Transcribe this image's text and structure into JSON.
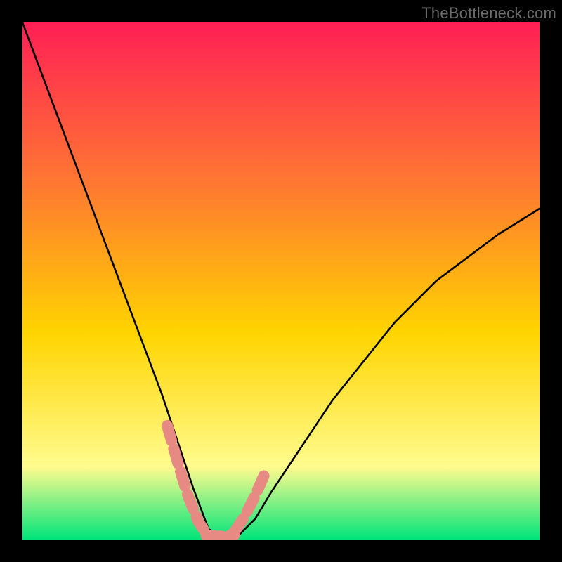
{
  "watermark": {
    "text": "TheBottleneck.com"
  },
  "colors": {
    "background": "#000000",
    "gradient_top": "#ff1f55",
    "gradient_mid1": "#ff7a30",
    "gradient_mid2": "#ffd400",
    "gradient_mid3": "#fffb8e",
    "gradient_bottom": "#00e47a",
    "curve": "#000000",
    "marker": "#e78a84"
  },
  "chart_data": {
    "type": "line",
    "title": "",
    "xlabel": "",
    "ylabel": "",
    "xlim": [
      0,
      100
    ],
    "ylim": [
      0,
      100
    ],
    "grid": false,
    "legend": false,
    "note": "Bottleneck-style curve: y ≈ percentage bottleneck vs. a sweep parameter; minimum (~0) around x≈34–41, rising on both sides.",
    "series": [
      {
        "name": "bottleneck-curve",
        "x": [
          0,
          3,
          6,
          9,
          12,
          15,
          18,
          21,
          24,
          27,
          30,
          33,
          36,
          39,
          42,
          45,
          48,
          52,
          56,
          60,
          64,
          68,
          72,
          76,
          80,
          84,
          88,
          92,
          96,
          100
        ],
        "y": [
          100,
          92,
          84,
          76,
          68,
          60,
          52,
          44,
          36,
          28,
          19,
          10,
          2,
          0.5,
          1,
          4,
          9,
          15,
          21,
          27,
          32,
          37,
          42,
          46,
          50,
          53,
          56,
          59,
          61.5,
          64
        ]
      }
    ],
    "markers": {
      "name": "emphasis-segments",
      "segments": [
        {
          "x": [
            28,
            30,
            32,
            34,
            35.5
          ],
          "y": [
            22,
            15,
            8.5,
            3.5,
            1.2
          ]
        },
        {
          "x": [
            35.5,
            38,
            41
          ],
          "y": [
            0.8,
            0.6,
            0.9
          ]
        },
        {
          "x": [
            41,
            43,
            45,
            47
          ],
          "y": [
            1.5,
            4.5,
            8.5,
            13
          ]
        }
      ]
    }
  }
}
